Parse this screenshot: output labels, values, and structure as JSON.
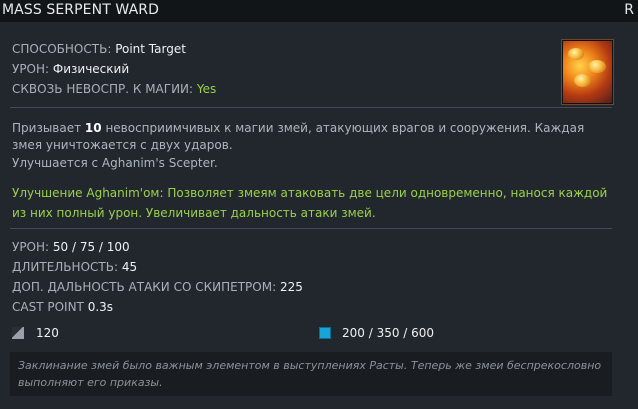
{
  "header": {
    "title": "MASS SERPENT WARD",
    "right_label": "R"
  },
  "ability": {
    "type_label": "СПОСОБНОСТЬ:",
    "type_value": "Point Target",
    "damage_label": "УРОН:",
    "damage_value": "Физический",
    "pierce_label": "СКВОЗЬ НЕВОСПР. К МАГИИ:",
    "pierce_value": "Yes"
  },
  "description": {
    "line1_pre": "Призывает ",
    "count": "10",
    "line1_post": " невосприимчивых к магии змей, атакующих врагов и сооружения. Каждая змея уничтожается с двух ударов.",
    "line2": "Улучшается с Aghanim's Scepter."
  },
  "aghanim": "Улучшение Aghanim'ом: Позволяет змеям атаковать две цели одновременно, нанося каждой из них полный урон. Увеличивает дальность атаки змей.",
  "stats": {
    "dmg_label": "УРОН:",
    "dmg_value": "50 / 75 / 100",
    "dur_label": "ДЛИТЕЛЬНОСТЬ:",
    "dur_value": "45",
    "range_label": "ДОП. ДАЛЬНОСТЬ АТАКИ СО СКИПЕТРОМ:",
    "range_value": "225",
    "cast_label": "CAST POINT",
    "cast_value": "0.3s"
  },
  "costs": {
    "cooldown": "120",
    "mana": "200 / 350 / 600"
  },
  "lore": "Заклинание змей было важным элементом в выступлениях Расты. Теперь же змеи беспрекословно выполняют его приказы.",
  "colors": {
    "accent_green": "#9ad14a",
    "mana_blue": "#1aa3d6"
  },
  "icons": {
    "hero": "serpent-ward-icon",
    "cooldown": "cooldown-icon",
    "mana": "mana-icon"
  }
}
